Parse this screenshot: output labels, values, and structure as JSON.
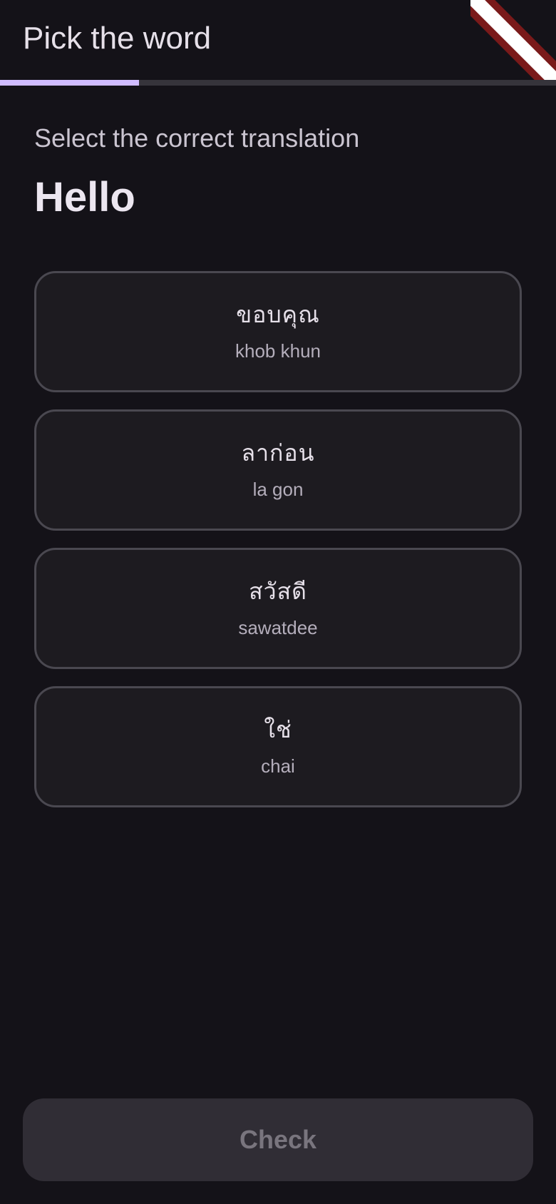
{
  "app_bar": {
    "title": "Pick the word"
  },
  "progress": {
    "fraction": 0.25,
    "fill_color": "#d0bcff",
    "track_color": "#36343b"
  },
  "question": {
    "prompt": "Select the correct translation",
    "word": "Hello"
  },
  "options": [
    {
      "native": "ขอบคุณ",
      "romanization": "khob khun"
    },
    {
      "native": "ลาก่อน",
      "romanization": "la gon"
    },
    {
      "native": "สวัสดี",
      "romanization": "sawatdee"
    },
    {
      "native": "ใช่",
      "romanization": "chai"
    }
  ],
  "footer": {
    "check_label": "Check"
  },
  "colors": {
    "background": "#141218",
    "card_border": "#4a4850",
    "debug_banner": "#7a1a1a"
  }
}
